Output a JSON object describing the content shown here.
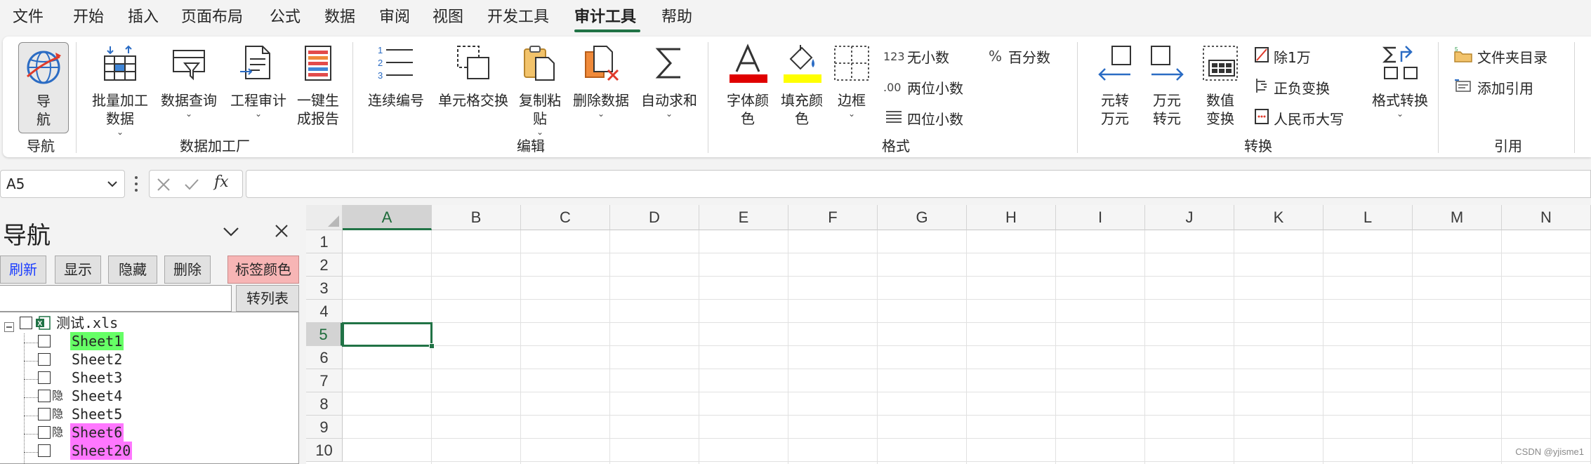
{
  "menubar": {
    "items": [
      "文件",
      "开始",
      "插入",
      "页面布局",
      "公式",
      "数据",
      "审阅",
      "视图",
      "开发工具",
      "审计工具",
      "帮助"
    ],
    "active_index": 9
  },
  "ribbon": {
    "nav": {
      "button": "导\n航",
      "group": "导航"
    },
    "data_factory": {
      "group": "数据加工厂",
      "buttons": [
        "批量加工\n数据",
        "数据查询",
        "工程审计",
        "一键生\n成报告"
      ]
    },
    "edit": {
      "group": "编辑",
      "buttons": [
        "连续编号",
        "单元格交换",
        "复制粘\n贴",
        "删除数据",
        "自动求和"
      ]
    },
    "format": {
      "group": "格式",
      "buttons": [
        "字体颜\n色",
        "填充颜\n色",
        "边框"
      ],
      "small": [
        "无小数",
        "两位小数",
        "四位小数",
        "百分数"
      ],
      "small_icons": [
        "123",
        ".00",
        "",
        "%"
      ],
      "font_color_bar": "#e00000",
      "fill_color_bar": "#ffff00"
    },
    "convert": {
      "group": "转换",
      "buttons": [
        "元转\n万元",
        "万元\n转元",
        "数值\n变换",
        "格式转换"
      ],
      "small": [
        "除1万",
        "正负变换",
        "人民币大写"
      ]
    },
    "reference": {
      "group": "引用",
      "small": [
        "文件夹目录",
        "添加引用"
      ]
    }
  },
  "formula_bar": {
    "name_box": "A5",
    "fx": "fx",
    "value": ""
  },
  "nav_pane": {
    "title": "导航",
    "buttons": [
      "刷新",
      "显示",
      "隐藏",
      "删除",
      "标签颜色"
    ],
    "convert_button": "转列表",
    "search_value": "",
    "tree": {
      "file": "测试.xls",
      "sheets": [
        {
          "name": "Sheet1",
          "hidden_tag": "",
          "highlight": "#66ff66"
        },
        {
          "name": "Sheet2",
          "hidden_tag": "",
          "highlight": ""
        },
        {
          "name": "Sheet3",
          "hidden_tag": "",
          "highlight": ""
        },
        {
          "name": "Sheet4",
          "hidden_tag": "隐",
          "highlight": ""
        },
        {
          "name": "Sheet5",
          "hidden_tag": "隐",
          "highlight": ""
        },
        {
          "name": "Sheet6",
          "hidden_tag": "隐",
          "highlight": "#ff77ff"
        },
        {
          "name": "Sheet20",
          "hidden_tag": "",
          "highlight": "#ff77ff"
        }
      ]
    }
  },
  "grid": {
    "columns": [
      "A",
      "B",
      "C",
      "D",
      "E",
      "F",
      "G",
      "H",
      "I",
      "J",
      "K",
      "L",
      "M",
      "N"
    ],
    "rows": [
      "1",
      "2",
      "3",
      "4",
      "5",
      "6",
      "7",
      "8",
      "9",
      "10"
    ],
    "active_col": "A",
    "active_row": "5"
  },
  "watermark": "CSDN @yjisme1"
}
